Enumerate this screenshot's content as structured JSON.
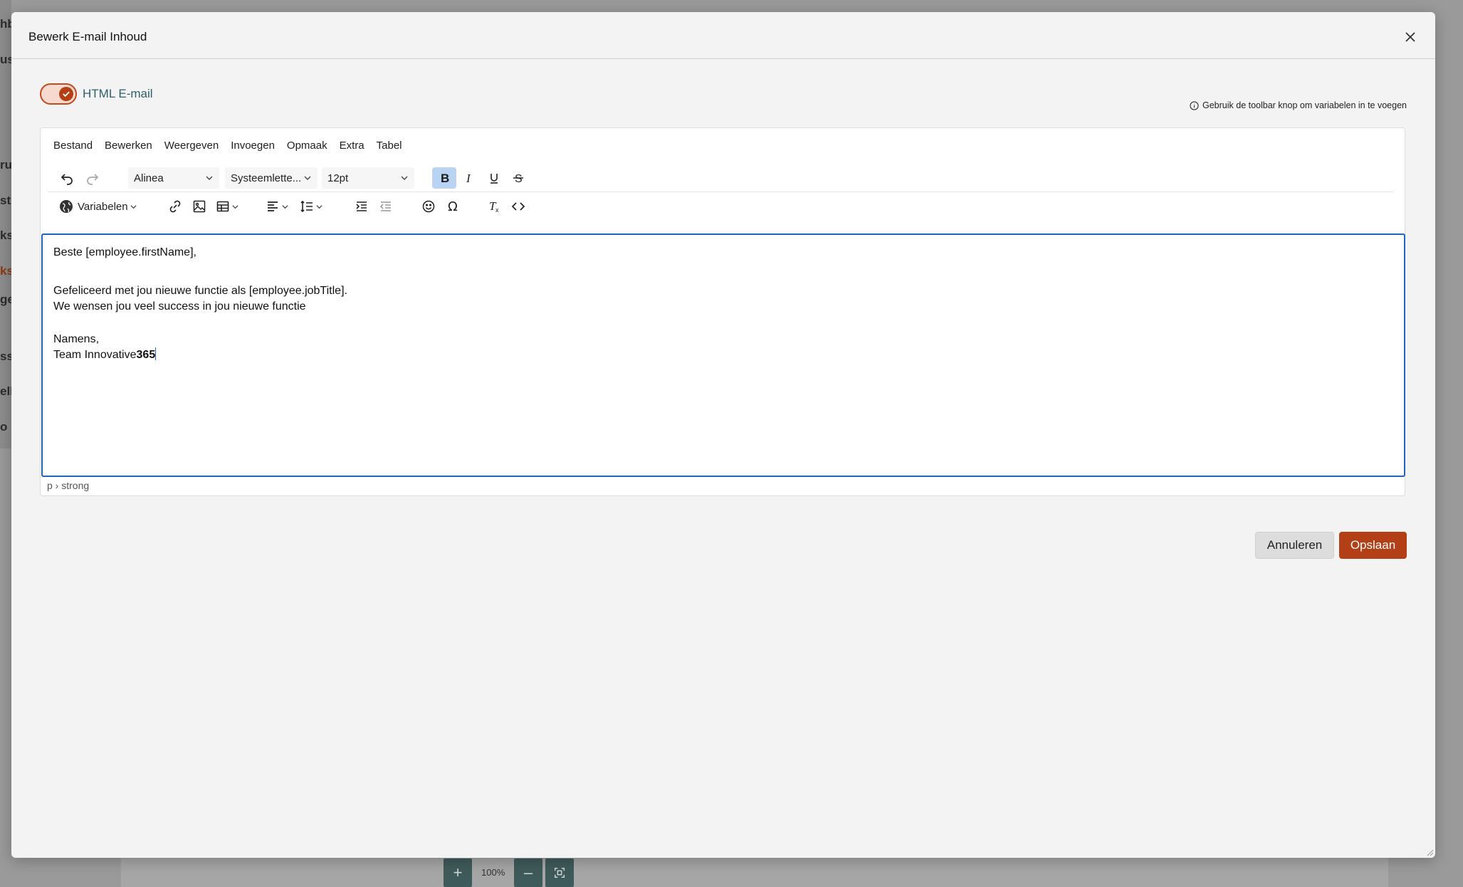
{
  "background": {
    "sidebar_fragments": [
      "hb",
      "us",
      "ru",
      "str",
      "ks",
      "ks",
      "ge",
      "ss",
      "ell",
      "o &"
    ],
    "zoom": {
      "plus": "+",
      "percent": "100%",
      "minus": "–"
    }
  },
  "modal": {
    "title": "Bewerk E-mail Inhoud",
    "html_toggle": {
      "label": "HTML E-mail",
      "checked": true
    },
    "hint": "Gebruik de toolbar knop om variabelen in te voegen",
    "menubar": [
      "Bestand",
      "Bewerken",
      "Weergeven",
      "Invoegen",
      "Opmaak",
      "Extra",
      "Tabel"
    ],
    "toolbar": {
      "block_format": "Alinea",
      "font_family": "Systeemlette...",
      "font_size": "12pt",
      "variables_label": "Variabelen",
      "icons": [
        "undo-icon",
        "redo-icon",
        "bold-icon",
        "italic-icon",
        "underline-icon",
        "strikethrough-icon",
        "globe-icon",
        "link-icon",
        "image-icon",
        "table-icon",
        "align-left-icon",
        "line-height-icon",
        "indent-icon",
        "outdent-icon",
        "emoji-icon",
        "special-char-icon",
        "clear-format-icon",
        "source-code-icon"
      ]
    },
    "content": {
      "greeting": "Beste [employee.firstName],",
      "line1": "Gefeliceerd met jou nieuwe functie als [employee.jobTitle].",
      "line2": "We wensen jou veel success in jou nieuwe functie",
      "closing": "Namens,",
      "signature_plain": "Team Innovative",
      "signature_bold": "365"
    },
    "statusbar": "p › strong",
    "buttons": {
      "cancel": "Annuleren",
      "save": "Opslaan"
    },
    "colors": {
      "accent": "#b23f15",
      "focus": "#1f66c1",
      "toggle_label": "#2f5f6a"
    }
  }
}
